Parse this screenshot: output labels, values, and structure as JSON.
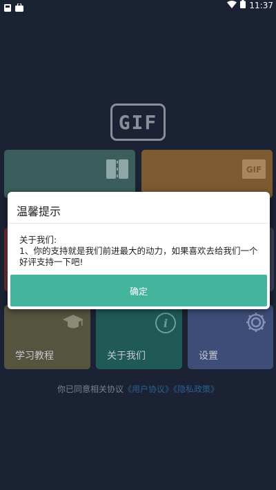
{
  "status_bar": {
    "time": "11:37",
    "icons": [
      "notification-icon",
      "shopping-bag-icon",
      "wifi-icon",
      "battery-icon"
    ]
  },
  "app": {
    "logo_text": "GIF"
  },
  "tiles": {
    "learning": {
      "label": "学习教程",
      "icon": "graduation-cap-icon"
    },
    "about": {
      "label": "关于我们",
      "icon": "info-icon"
    },
    "settings": {
      "label": "设置",
      "icon": "gear-icon"
    }
  },
  "agreement": {
    "prefix": "你已同意相关协议",
    "user_agreement": "《用户协议》",
    "privacy_policy": "《隐私政策》"
  },
  "dialog": {
    "title": "温馨提示",
    "body_line1": "关于我们:",
    "body_line2": "1、你的支持就是我们前进最大的动力，如果喜欢去给我们一个好评支持一下吧!",
    "ok_label": "确定"
  },
  "colors": {
    "background": "#1b2233",
    "accent": "#45b49c"
  }
}
